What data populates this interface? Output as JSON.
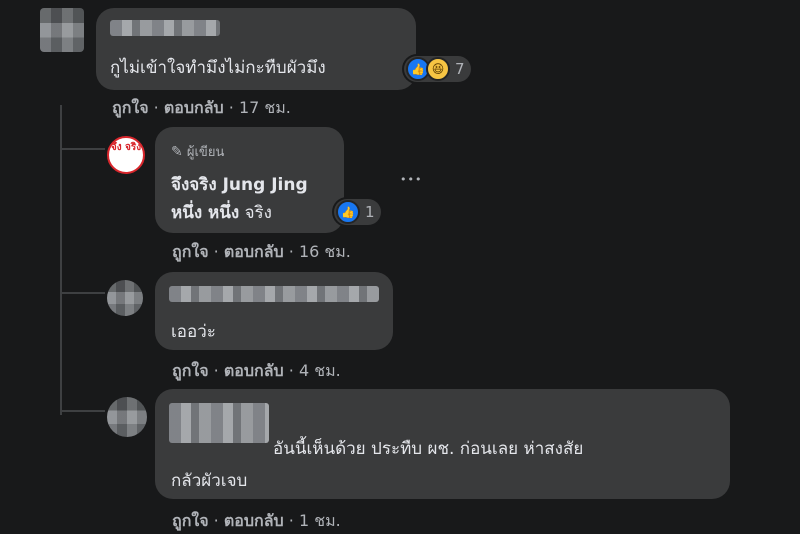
{
  "comments": [
    {
      "text": "กูไม่เข้าใจทำมึงไม่กะทืบผัวมึง",
      "reaction_count": "7",
      "actions": {
        "like": "ถูกใจ",
        "reply": "ตอบกลับ",
        "sep": "·",
        "time": "17 ชม."
      }
    },
    {
      "author_badge": "ผู้เขียน",
      "author_name": "จึงจริง Jung Jing",
      "avatar_text": "จึง จริง",
      "text_bold": "หนึ่ง หนึ่ง",
      "text_rest": " จริง",
      "reaction_count": "1",
      "more": "•••",
      "actions": {
        "like": "ถูกใจ",
        "reply": "ตอบกลับ",
        "sep": "·",
        "time": "16 ชม."
      }
    },
    {
      "text": "เออว่ะ",
      "actions": {
        "like": "ถูกใจ",
        "reply": "ตอบกลับ",
        "sep": "·",
        "time": "4 ชม."
      }
    },
    {
      "text_line1": "อันนี้เห็นด้วย ประทืบ ผช. ก่อนเลย ห่าสงสัย",
      "text_line2": "กลัวผัวเจบ",
      "actions": {
        "like": "ถูกใจ",
        "reply": "ตอบกลับ",
        "sep": "·",
        "time": "1 ชม."
      }
    }
  ],
  "colors": {
    "background": "#18191a",
    "bubble": "#3a3b3c",
    "like_blue": "#1877f2",
    "haha_yellow": "#f7c543",
    "author_avatar_red": "#d8262c"
  },
  "icons": [
    "like-icon",
    "haha-icon",
    "pencil-icon",
    "more-options-icon"
  ]
}
